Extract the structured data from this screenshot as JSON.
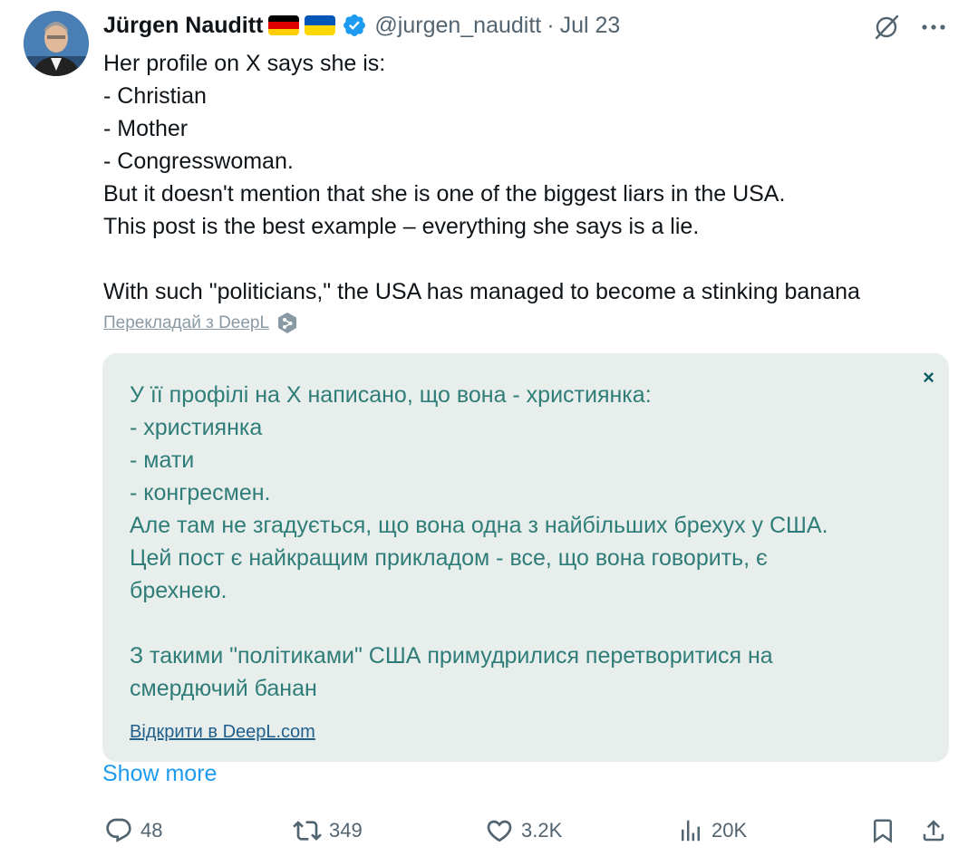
{
  "author": {
    "name": "Jürgen Nauditt",
    "handle": "@jurgen_nauditt",
    "date": "Jul 23",
    "separator": "·",
    "flags": [
      "germany-flag",
      "ukraine-flag"
    ]
  },
  "tweet": {
    "lines": [
      "Her profile on X says she is:",
      "- Christian",
      "- Mother",
      "- Congresswoman.",
      "But it doesn't mention that she is one of the biggest liars in the USA.",
      "This post is the best example – everything she says is a lie.",
      "",
      "With such \"politicians,\" the USA has managed to become a stinking banana"
    ]
  },
  "translation": {
    "link_label": "Перекладай з DeepL",
    "close_label": "×",
    "lines": [
      "У її профілі на Х написано, що вона - християнка:",
      "- християнка",
      "- мати",
      "- конгресмен.",
      "Але там не згадується, що вона одна з найбільших брехух у США.",
      "Цей пост є найкращим прикладом - все, що вона говорить, є",
      "брехнею.",
      "",
      "З такими \"політиками\" США примудрилися перетворитися на",
      "смердючий банан"
    ],
    "open_link": "Відкрити в DeepL.com"
  },
  "show_more": "Show more",
  "actions": {
    "replies": "48",
    "reposts": "349",
    "likes": "3.2K",
    "views": "20K"
  },
  "colors": {
    "accent": "#1d9bf0",
    "muted": "#536471",
    "translation_bg": "#e8eeec",
    "translation_text": "#2f7d78"
  }
}
